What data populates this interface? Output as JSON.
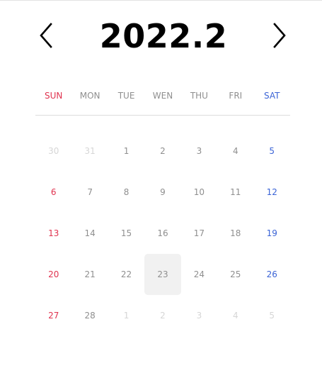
{
  "header": {
    "title": "2022.2",
    "prev_icon": "chevron-left-icon",
    "next_icon": "chevron-right-icon"
  },
  "weekdays": [
    {
      "label": "SUN",
      "color": "#e0334f"
    },
    {
      "label": "MON",
      "color": "#8f8f8f"
    },
    {
      "label": "TUE",
      "color": "#8f8f8f"
    },
    {
      "label": "WEN",
      "color": "#8f8f8f"
    },
    {
      "label": "THU",
      "color": "#8f8f8f"
    },
    {
      "label": "FRI",
      "color": "#8f8f8f"
    },
    {
      "label": "SAT",
      "color": "#3b64d6"
    }
  ],
  "colors": {
    "sunday": "#e0334f",
    "saturday": "#3b64d6",
    "weekday": "#8f8f8f",
    "outside_month": "#d6d6d6",
    "selected_bg": "#f1f1f1"
  },
  "weeks": [
    [
      {
        "day": "30",
        "outside": true
      },
      {
        "day": "31",
        "outside": true
      },
      {
        "day": "1"
      },
      {
        "day": "2"
      },
      {
        "day": "3"
      },
      {
        "day": "4"
      },
      {
        "day": "5"
      }
    ],
    [
      {
        "day": "6"
      },
      {
        "day": "7"
      },
      {
        "day": "8"
      },
      {
        "day": "9"
      },
      {
        "day": "10"
      },
      {
        "day": "11"
      },
      {
        "day": "12"
      }
    ],
    [
      {
        "day": "13"
      },
      {
        "day": "14"
      },
      {
        "day": "15"
      },
      {
        "day": "16"
      },
      {
        "day": "17"
      },
      {
        "day": "18"
      },
      {
        "day": "19"
      }
    ],
    [
      {
        "day": "20"
      },
      {
        "day": "21"
      },
      {
        "day": "22"
      },
      {
        "day": "23",
        "selected": true
      },
      {
        "day": "24"
      },
      {
        "day": "25"
      },
      {
        "day": "26"
      }
    ],
    [
      {
        "day": "27"
      },
      {
        "day": "28"
      },
      {
        "day": "1",
        "outside": true
      },
      {
        "day": "2",
        "outside": true
      },
      {
        "day": "3",
        "outside": true
      },
      {
        "day": "4",
        "outside": true
      },
      {
        "day": "5",
        "outside": true
      }
    ]
  ]
}
